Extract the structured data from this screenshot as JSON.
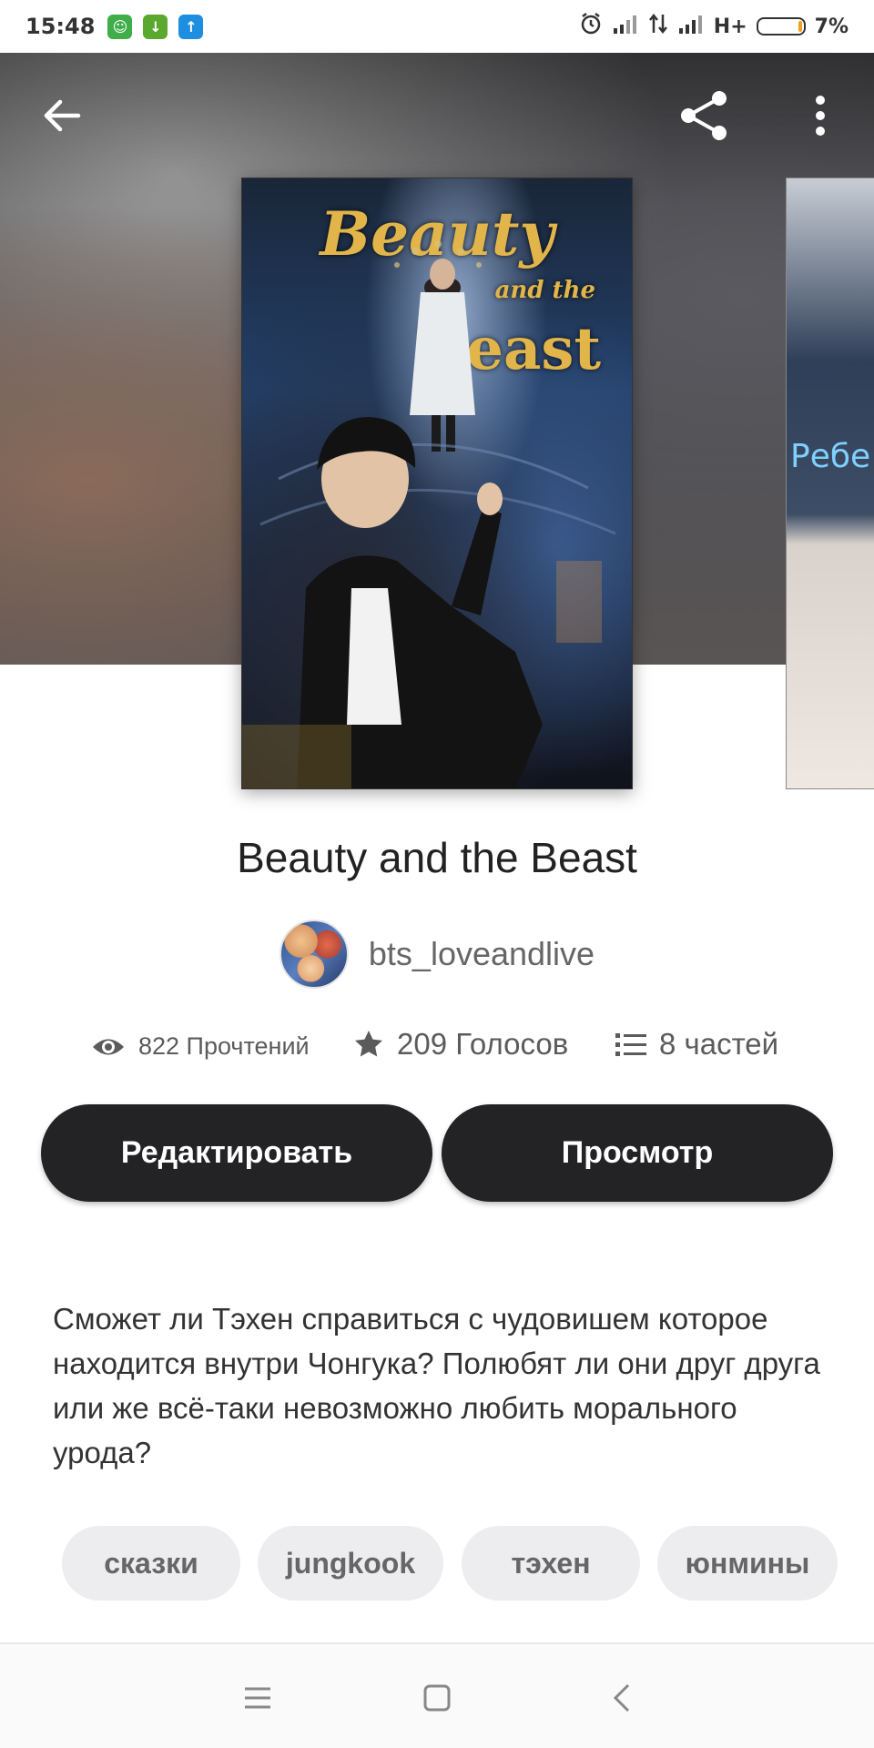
{
  "status_bar": {
    "time": "15:48",
    "network": "H+",
    "battery": "7%",
    "app_icons": [
      {
        "name": "android-icon",
        "color": "#3fae49",
        "glyph": "☺"
      },
      {
        "name": "download-icon",
        "color": "#5aa82e",
        "glyph": "↓"
      },
      {
        "name": "upload-icon",
        "color": "#1e8ee0",
        "glyph": "↑"
      }
    ]
  },
  "story": {
    "cover_title_line1": "Beauty",
    "cover_title_line2": "and the",
    "cover_title_line3": "Beast",
    "side_cover_text": "Ребе",
    "title": "Beauty and the Beast",
    "author": "bts_loveandlive",
    "reads": "822 Прочтений",
    "votes": "209 Голосов",
    "parts": "8 частей",
    "description": "Сможет ли Тэхен справиться с чудовишем которое находится внутри Чонгука? Полюбят ли они друг друга или же всё-таки невозможно любить морального урода?"
  },
  "actions": {
    "edit_label": "Редактировать",
    "view_label": "Просмотр"
  },
  "tags": [
    "сказки",
    "jungkook",
    "тэхен",
    "юнмины"
  ],
  "colors": {
    "button_bg": "#232225",
    "tag_bg": "#ededef",
    "cover_title": "#e2b54a"
  }
}
